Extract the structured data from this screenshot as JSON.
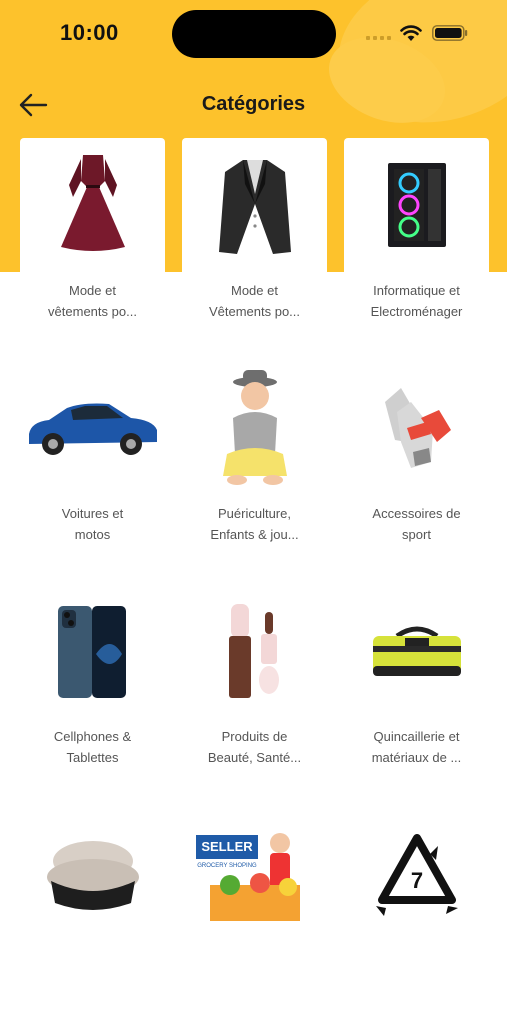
{
  "status_bar": {
    "time": "10:00"
  },
  "header": {
    "title": "Catégories"
  },
  "categories": [
    {
      "line1": "Mode et",
      "line2": "vêtements po...",
      "icon": "dress-icon"
    },
    {
      "line1": "Mode et",
      "line2": "Vêtements po...",
      "icon": "suit-jacket-icon"
    },
    {
      "line1": "Informatique et",
      "line2": "Electroménager",
      "icon": "computer-tower-icon"
    },
    {
      "line1": "Voitures et",
      "line2": "motos",
      "icon": "car-icon"
    },
    {
      "line1": "Puériculture,",
      "line2": "Enfants & jou...",
      "icon": "baby-icon"
    },
    {
      "line1": "Accessoires de",
      "line2": "sport",
      "icon": "gloves-icon"
    },
    {
      "line1": "Cellphones &",
      "line2": "Tablettes",
      "icon": "smartphone-icon"
    },
    {
      "line1": "Produits de",
      "line2": "Beauté, Santé...",
      "icon": "concealer-icon"
    },
    {
      "line1": "Quincaillerie et",
      "line2": "matériaux de ...",
      "icon": "tool-bag-icon"
    },
    {
      "line1": "",
      "line2": "",
      "icon": "armchair-icon"
    },
    {
      "line1": "",
      "line2": "",
      "icon": "grocery-seller-icon",
      "badge": "SELLER",
      "badge_sub": "GROCERY SHOPING"
    },
    {
      "line1": "",
      "line2": "",
      "icon": "recycle-7-icon",
      "badge": "7"
    }
  ],
  "colors": {
    "header": "#fdc22c",
    "text": "#555555",
    "title": "#1a1a1a"
  }
}
